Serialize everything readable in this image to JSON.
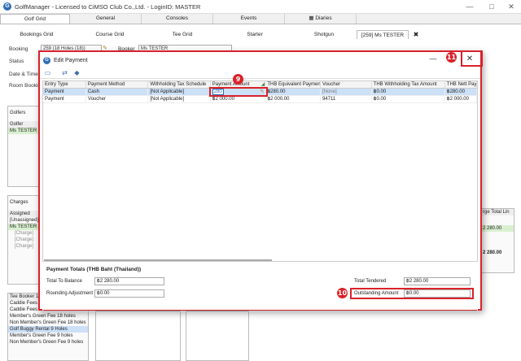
{
  "window": {
    "title": "GolfManager - Licensed to CiMSO Club Co.,Ltd. - LoginID: MASTER"
  },
  "main_tabs": [
    "Golf Grid",
    "General",
    "Consoles",
    "Events",
    "Diaries"
  ],
  "sub_tabs": [
    "Bookings Grid",
    "Course Grid",
    "Tee Grid",
    "Starter",
    "Shotgun",
    "[259] Ms TESTER"
  ],
  "booking_form": {
    "booking_label": "Booking",
    "booking_value": "259 (18 Holes (18))",
    "booker_label": "Booker",
    "booker_value": "Ms TESTER",
    "status_label": "Status",
    "datetime_label": "Date & Time",
    "room_label": "Room Booking"
  },
  "golfers_panel": {
    "title": "Golfers",
    "column": "Golfer",
    "rows": [
      "Ms TESTER"
    ]
  },
  "charges_panel": {
    "title": "Charges",
    "column": "Assigned",
    "rows": [
      "[Unassigned]",
      "Ms TESTER",
      "[Charge]",
      "[Charge]",
      "[Charge]"
    ],
    "right_header": "rge Total",
    "right_header2": "Lin",
    "right_value": "2 280.00",
    "right_total": "2 280.00"
  },
  "tee_booker_panel": {
    "title": "Tee Booker 1",
    "items": [
      "Caddie Fees",
      "Caddie Fees 9 holes",
      "Member's Green Fee 18 holes",
      "Non Member's Green Fee 18 holes",
      "Golf Buggy Rental 9 Holes",
      "Member's Green Fee 9 holes",
      "Non Member's Green Fee 9 holes"
    ]
  },
  "dialog": {
    "title": "Edit Payment",
    "columns": [
      "Entry Type",
      "Payment Method",
      "Withholding Tax Schedule",
      "Payment Amount",
      "THB Equivalent Payment",
      "Voucher",
      "THB Withholding Tax Amount",
      "THB Nett Pay"
    ],
    "rows": [
      [
        "Payment",
        "Cash",
        "[Not Applicable]",
        "280",
        "฿280.00",
        "[None]",
        "฿0.00",
        "฿280.00"
      ],
      [
        "Payment",
        "Voucher",
        "[Not Applicable]",
        "฿2 000.00",
        "฿2 000.00",
        "94711",
        "฿0.00",
        "฿2 000.00"
      ]
    ],
    "totals": {
      "title": "Payment Totals (THB Baht (Thailand))",
      "to_balance_label": "Total To Balance",
      "to_balance_value": "฿2 280.00",
      "rounding_label": "Rounding Adjustment",
      "rounding_value": "฿0.00",
      "tendered_label": "Total Tendered",
      "tendered_value": "฿2 280.00",
      "outstanding_label": "Outstanding Amount",
      "outstanding_value": "฿0.00"
    }
  },
  "badges": {
    "b9": "9",
    "b10": "10",
    "b11": "11"
  },
  "colors": {
    "highlight_red": "#d9222a",
    "selection_blue": "#cce0f7",
    "brand_blue": "#2f6db5"
  }
}
